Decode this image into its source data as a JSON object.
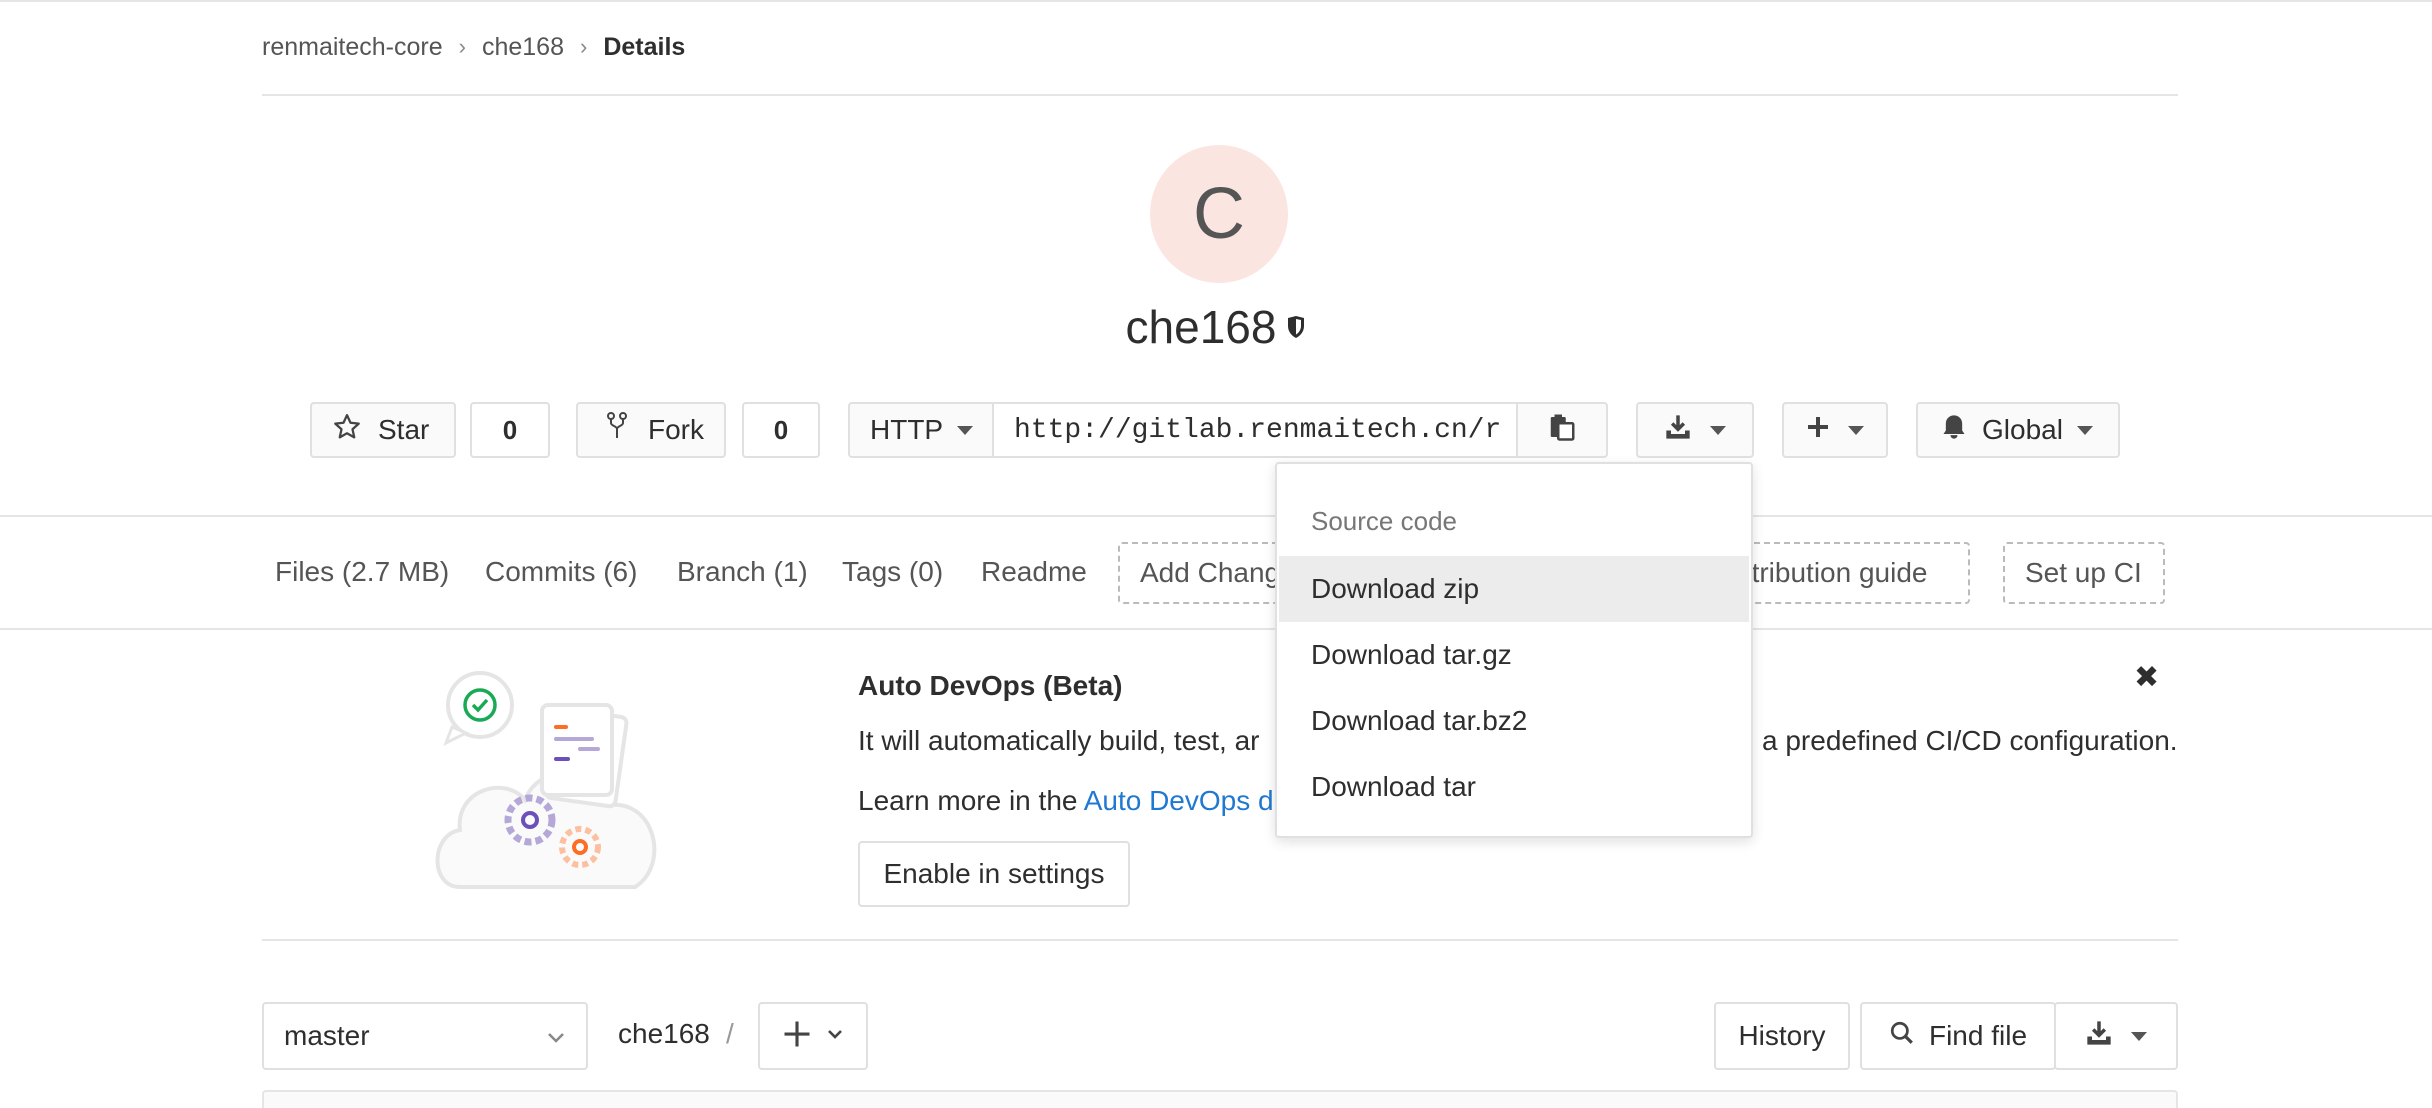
{
  "breadcrumb": {
    "items": [
      "renmaitech-core",
      "che168"
    ],
    "current": "Details"
  },
  "project": {
    "avatar_letter": "C",
    "name": "che168"
  },
  "actions": {
    "star_label": "Star",
    "star_count": "0",
    "fork_label": "Fork",
    "fork_count": "0",
    "protocol": "HTTP",
    "clone_url": "http://gitlab.renmaitech.cn/r",
    "notification_label": "Global"
  },
  "nav": {
    "files": "Files (2.7 MB)",
    "commits": "Commits (6)",
    "branch": "Branch (1)",
    "tags": "Tags (0)",
    "readme": "Readme",
    "add_changelog": "Add Chang",
    "contribution_guide": "ntribution guide",
    "setup_ci": "Set up CI"
  },
  "banner": {
    "title": "Auto DevOps (Beta)",
    "text_line1_start": "It will automatically build, test, ar",
    "text_line1_end": "a predefined CI/CD configuration.",
    "text_line2_prefix": "Learn more in the ",
    "text_line2_link": "Auto DevOps d",
    "enable_button": "Enable in settings",
    "close_symbol": "✖"
  },
  "download_menu": {
    "header": "Source code",
    "items": [
      "Download zip",
      "Download tar.gz",
      "Download tar.bz2",
      "Download tar"
    ],
    "active_index": 0
  },
  "tree": {
    "branch": "master",
    "path": "che168",
    "separator": "/",
    "history_button": "History",
    "find_file_button": "Find file"
  },
  "colors": {
    "link": "#1f78d1",
    "avatar_bg": "#fbe5e1",
    "border": "#e0e0e0"
  }
}
